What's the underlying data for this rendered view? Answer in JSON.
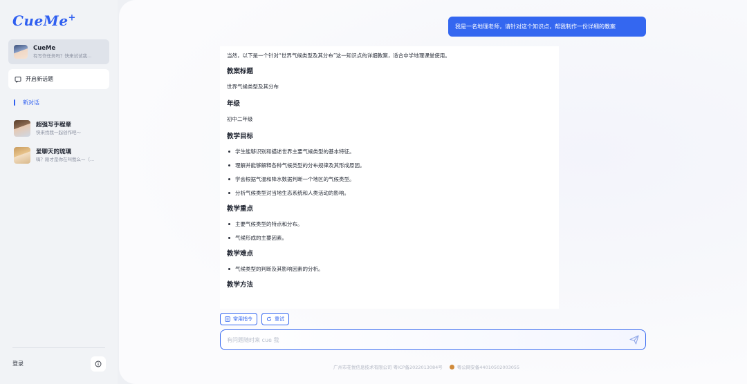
{
  "app": {
    "logo": "CueMe",
    "logo_plus": "+"
  },
  "sidebar": {
    "bots": [
      {
        "name": "CueMe",
        "desc": "有写作任务吗？快来试试我..."
      }
    ],
    "new_topic_label": "开启新话题",
    "new_chat_label": "新对话",
    "history": [
      {
        "name": "超强写手程章",
        "desc": "快来找我一起创作吧～"
      },
      {
        "name": "爱聊天的琉璃",
        "desc": "嗨？刚才是你在叫我么～（..."
      }
    ],
    "login_label": "登录"
  },
  "chat": {
    "user_message": "我是一名地理老师，请针对这个知识点，帮我制作一份详细的教案",
    "answer": {
      "intro": "当然，以下是一个针对“世界气候类型及其分布”这一知识点的详细教案，适合中学地理课堂使用。",
      "sections": [
        {
          "heading": "教案标题",
          "text": "世界气候类型及其分布"
        },
        {
          "heading": "年级",
          "text": "初中二年级"
        },
        {
          "heading": "教学目标",
          "items": [
            "学生能够识别和描述世界主要气候类型的基本特征。",
            "理解并能够解释各种气候类型的分布规律及其形成原因。",
            "学会根据气温和降水数据判断一个地区的气候类型。",
            "分析气候类型对当地生态系统和人类活动的影响。"
          ]
        },
        {
          "heading": "教学重点",
          "items": [
            "主要气候类型的特点和分布。",
            "气候形成的主要因素。"
          ]
        },
        {
          "heading": "教学难点",
          "items": [
            "气候类型的判断及其影响因素的分析。"
          ]
        },
        {
          "heading": "教学方法"
        }
      ]
    },
    "chips": {
      "commands": "常用指令",
      "retry": "重试"
    },
    "input_placeholder": "有问题随时来 cue 我",
    "footer": {
      "company": "广州市花悦信息技术有限公司 粤ICP备2022013084号",
      "police": "粤公网安备44010502003055"
    }
  },
  "colors": {
    "accent": "#3467f0",
    "sidebar_bg": "#f1f3f6",
    "user_bubble": "#3467f0"
  }
}
